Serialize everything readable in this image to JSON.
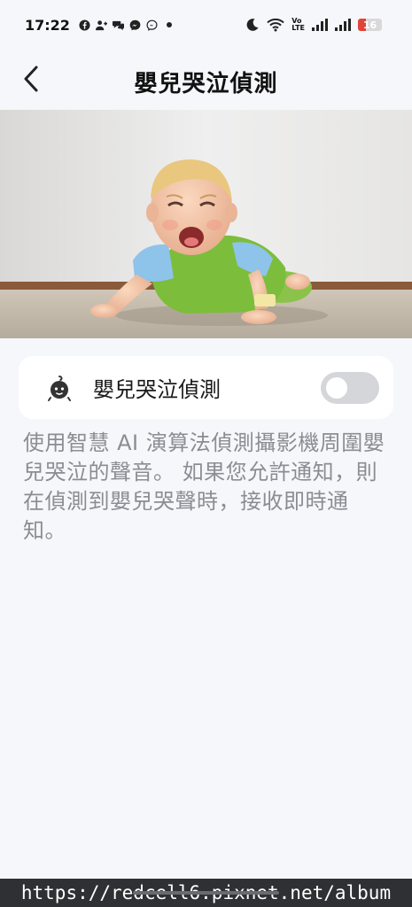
{
  "status_bar": {
    "time": "17:22",
    "battery_level": "16",
    "network_label_top": "Vo",
    "network_label_bottom": "LTE"
  },
  "header": {
    "title": "嬰兒哭泣偵測"
  },
  "hero": {
    "description": "crying baby crawling on carpet"
  },
  "setting": {
    "label": "嬰兒哭泣偵測",
    "toggle_on": false,
    "icon": "baby-face-icon"
  },
  "description": "使用智慧 AI 演算法偵測攝影機周圍嬰兒哭泣的聲音。 如果您允許通知，則在偵測到嬰兒哭聲時，接收即時通知。",
  "watermark": "https://redcell6.pixnet.net/album",
  "colors": {
    "background": "#f6f7fb",
    "card": "#ffffff",
    "toggle_off": "#d4d6da",
    "description_text": "#8a8d93",
    "battery_low": "#e0453a"
  }
}
